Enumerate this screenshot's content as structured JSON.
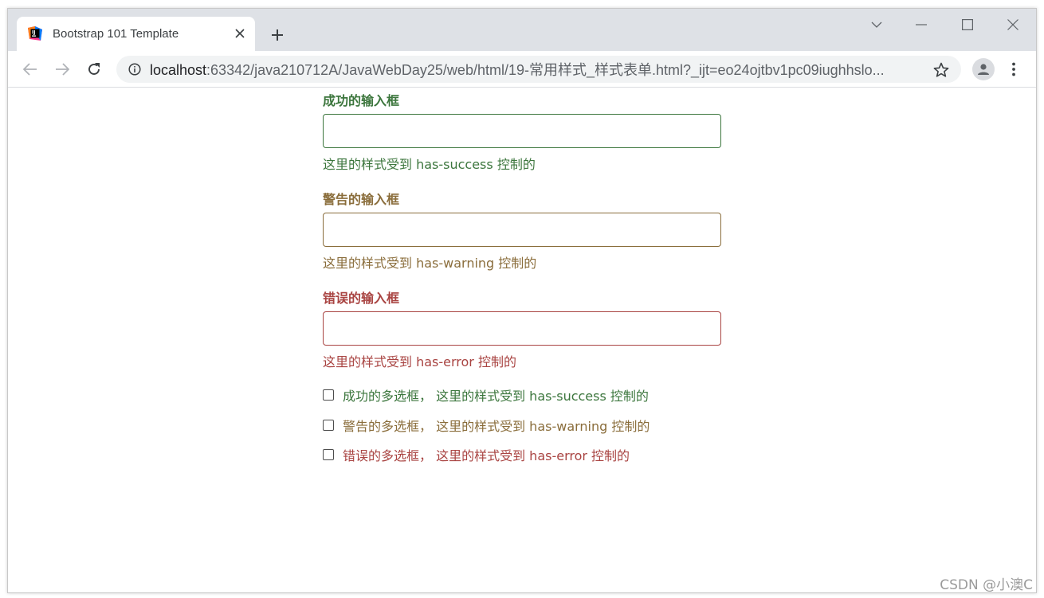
{
  "browser": {
    "tab_title": "Bootstrap 101 Template",
    "url_host": "localhost",
    "url_rest": ":63342/java210712A/JavaWebDay25/web/html/19-常用样式_样式表单.html?_ijt=eo24ojtbv1pc09iughhslo...",
    "icons": {
      "favicon": "jetbrains-icon",
      "close": "close-icon",
      "new_tab": "plus-icon",
      "back": "arrow-left-icon",
      "forward": "arrow-right-icon",
      "reload": "reload-icon",
      "info": "info-icon",
      "star": "star-icon",
      "profile": "account-icon",
      "menu": "kebab-menu-icon"
    }
  },
  "form": {
    "success": {
      "label": "成功的输入框",
      "value": "",
      "help": "这里的样式受到 has-success 控制的"
    },
    "warning": {
      "label": "警告的输入框",
      "value": "",
      "help": "这里的样式受到 has-warning 控制的"
    },
    "error": {
      "label": "错误的输入框",
      "value": "",
      "help": "这里的样式受到 has-error 控制的"
    },
    "checkboxes": {
      "success": "成功的多选框， 这里的样式受到 has-success 控制的",
      "warning": "警告的多选框， 这里的样式受到 has-warning 控制的",
      "error": "错误的多选框， 这里的样式受到 has-error 控制的"
    }
  },
  "colors": {
    "success": "#3c763d",
    "warning": "#8a6d3b",
    "error": "#a94442"
  },
  "watermark": "CSDN @小澳C"
}
